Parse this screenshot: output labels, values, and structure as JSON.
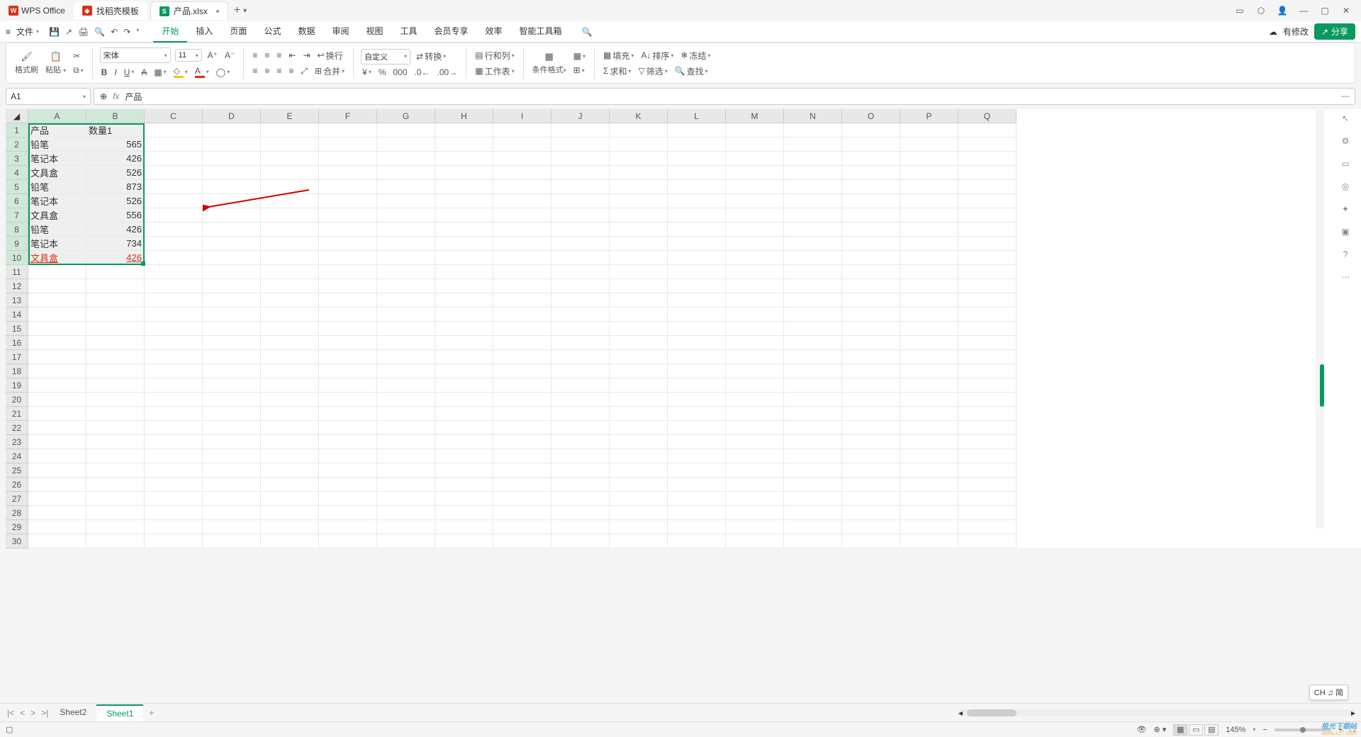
{
  "app": {
    "name": "WPS Office"
  },
  "tabs": {
    "template": {
      "label": "找稻壳模板"
    },
    "file": {
      "label": "产品.xlsx"
    }
  },
  "menu": {
    "file": "文件",
    "items": [
      "开始",
      "插入",
      "页面",
      "公式",
      "数据",
      "审阅",
      "视图",
      "工具",
      "会员专享",
      "效率",
      "智能工具箱"
    ],
    "active": 0,
    "modified": "有修改",
    "share": "分享"
  },
  "ribbon": {
    "format_painter": "格式刷",
    "paste": "粘贴",
    "font_name": "宋体",
    "font_size": "11",
    "wrap": "换行",
    "merge": "合并",
    "custom": "自定义",
    "convert": "转换",
    "rowcol": "行和列",
    "worksheet": "工作表",
    "cond_format": "条件格式",
    "fill": "填充",
    "sort": "排序",
    "freeze": "冻结",
    "sum": "求和",
    "filter": "筛选",
    "find": "查找"
  },
  "namebox": "A1",
  "formula": "产品",
  "columns": [
    "A",
    "B",
    "C",
    "D",
    "E",
    "F",
    "G",
    "H",
    "I",
    "J",
    "K",
    "L",
    "M",
    "N",
    "O",
    "P",
    "Q"
  ],
  "data_rows": [
    {
      "a": "产品",
      "b": "数量1",
      "num": false
    },
    {
      "a": "铅笔",
      "b": "565",
      "num": true
    },
    {
      "a": "笔记本",
      "b": "426",
      "num": true
    },
    {
      "a": "文具盒",
      "b": "526",
      "num": true
    },
    {
      "a": "铅笔",
      "b": "873",
      "num": true
    },
    {
      "a": "笔记本",
      "b": "526",
      "num": true
    },
    {
      "a": "文具盒",
      "b": "556",
      "num": true
    },
    {
      "a": "铅笔",
      "b": "426",
      "num": true
    },
    {
      "a": "笔记本",
      "b": "734",
      "num": true
    },
    {
      "a": "文具盒",
      "b": "426",
      "num": true,
      "link": true
    }
  ],
  "total_rows": 30,
  "sheets": {
    "list": [
      "Sheet2",
      "Sheet1"
    ],
    "active": 1
  },
  "status": {
    "zoom": "145%",
    "ime": "CH ♫ 简"
  },
  "watermark": {
    "line1": "极光下载站",
    "line2": "www.xz7.com"
  }
}
